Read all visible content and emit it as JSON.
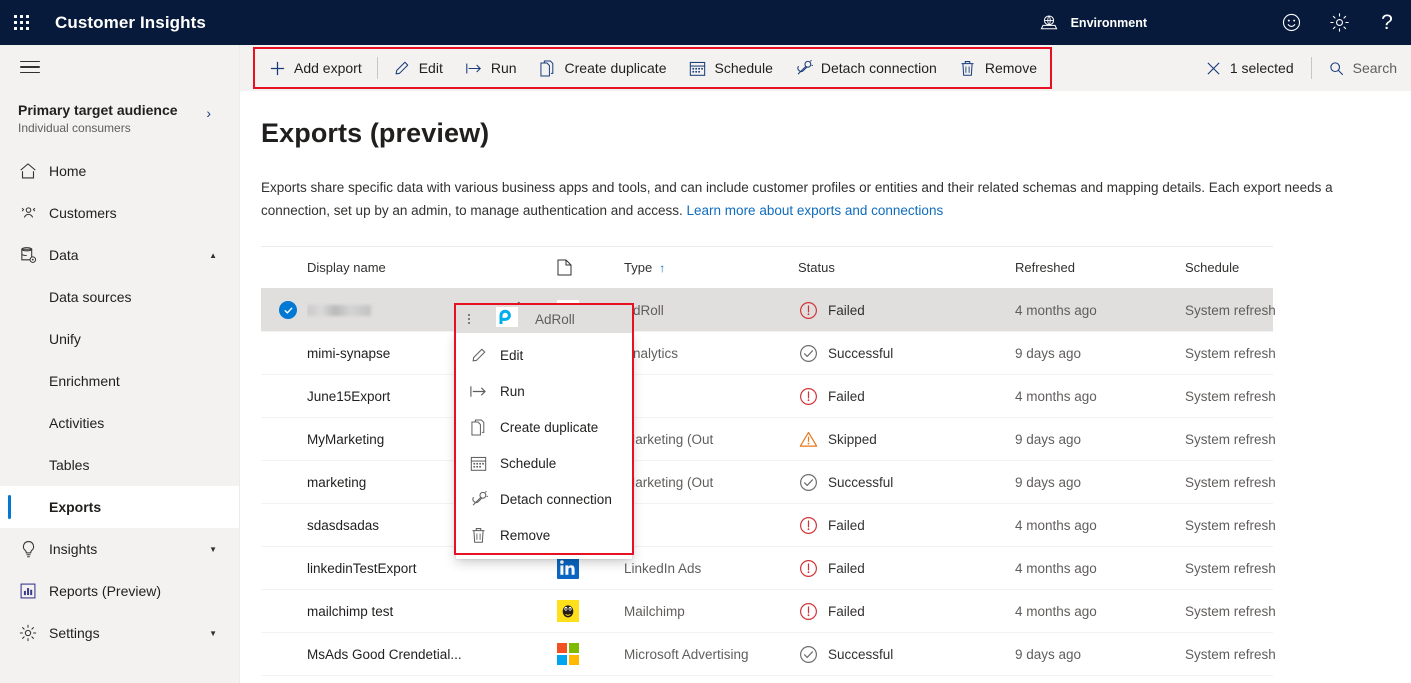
{
  "topbar": {
    "waffle_name": "app-launcher",
    "app_title": "Customer Insights",
    "environment_label": "Environment",
    "icons": [
      "feedback-smiley-icon",
      "gear-icon",
      "help-question-icon"
    ]
  },
  "commandbar": {
    "items": [
      {
        "label": "Add export",
        "icon": "plus-icon"
      },
      {
        "label": "Edit",
        "icon": "pencil-icon"
      },
      {
        "label": "Run",
        "icon": "run-arrow-icon"
      },
      {
        "label": "Create duplicate",
        "icon": "duplicate-icon"
      },
      {
        "label": "Schedule",
        "icon": "calendar-icon"
      },
      {
        "label": "Detach connection",
        "icon": "detach-plug-icon"
      },
      {
        "label": "Remove",
        "icon": "trash-icon"
      }
    ],
    "selected_label": "1 selected",
    "search_label": "Search",
    "highlight_color": "#E81123"
  },
  "sidebar": {
    "hamburger": "hamburger-menu-icon",
    "audience": {
      "title": "Primary target audience",
      "subtitle": "Individual consumers",
      "chevron": "chevron-right-icon"
    },
    "items": [
      {
        "label": "Home",
        "icon": "home-icon",
        "type": "top",
        "expandable": false,
        "active": false
      },
      {
        "label": "Customers",
        "icon": "people-icon",
        "type": "top",
        "expandable": false,
        "active": false
      },
      {
        "label": "Data",
        "icon": "database-icon",
        "type": "top",
        "expandable": true,
        "expanded": true,
        "active": false
      },
      {
        "label": "Data sources",
        "icon": "",
        "type": "sub",
        "expandable": false,
        "active": false
      },
      {
        "label": "Unify",
        "icon": "",
        "type": "sub",
        "expandable": false,
        "active": false
      },
      {
        "label": "Enrichment",
        "icon": "",
        "type": "sub",
        "expandable": false,
        "active": false
      },
      {
        "label": "Activities",
        "icon": "",
        "type": "sub",
        "expandable": false,
        "active": false
      },
      {
        "label": "Tables",
        "icon": "",
        "type": "sub",
        "expandable": false,
        "active": false
      },
      {
        "label": "Exports",
        "icon": "",
        "type": "sub",
        "expandable": false,
        "active": true
      },
      {
        "label": "Insights",
        "icon": "lightbulb-icon",
        "type": "top",
        "expandable": true,
        "expanded": false,
        "active": false
      },
      {
        "label": "Reports (Preview)",
        "icon": "report-chart-icon",
        "type": "top",
        "expandable": false,
        "active": false
      },
      {
        "label": "Settings",
        "icon": "gear-icon",
        "type": "top",
        "expandable": true,
        "expanded": false,
        "active": false
      }
    ]
  },
  "main": {
    "title": "Exports (preview)",
    "description_part1": "Exports share specific data with various business apps and tools, and can include customer profiles or entities and their related schemas and mapping details. Each export needs a connection, set up by an admin, to manage authentication and access. ",
    "description_link": "Learn more about exports and connections"
  },
  "table": {
    "columns": [
      "Display name",
      "Type",
      "Status",
      "Refreshed",
      "Schedule"
    ],
    "sort_column": "Type",
    "sort_direction": "ascending",
    "type_header_icon": "page-icon",
    "rows": [
      {
        "display_name": "",
        "redacted": true,
        "selected": true,
        "edit_icon": "pencil-icon",
        "type": "AdRoll",
        "logo": "adroll-logo",
        "status": "Failed",
        "status_icon": "error-circle-icon",
        "refreshed": "4 months ago",
        "schedule": "System refresh"
      },
      {
        "display_name": "mimi-synapse",
        "redacted": false,
        "selected": false,
        "edit_icon": "",
        "type": "Analytics",
        "logo": "",
        "status": "Successful",
        "status_icon": "check-circle-icon",
        "refreshed": "9 days ago",
        "schedule": "System refresh"
      },
      {
        "display_name": "June15Export",
        "redacted": false,
        "selected": false,
        "edit_icon": "",
        "type": "",
        "logo": "",
        "status": "Failed",
        "status_icon": "error-circle-icon",
        "refreshed": "4 months ago",
        "schedule": "System refresh"
      },
      {
        "display_name": "MyMarketing",
        "redacted": false,
        "selected": false,
        "edit_icon": "",
        "type": "Marketing (Out",
        "logo": "",
        "status": "Skipped",
        "status_icon": "warning-triangle-icon",
        "refreshed": "9 days ago",
        "schedule": "System refresh"
      },
      {
        "display_name": "marketing",
        "redacted": false,
        "selected": false,
        "edit_icon": "",
        "type": "Marketing (Out",
        "logo": "",
        "status": "Successful",
        "status_icon": "check-circle-icon",
        "refreshed": "9 days ago",
        "schedule": "System refresh"
      },
      {
        "display_name": "sdasdsadas",
        "redacted": false,
        "selected": false,
        "edit_icon": "",
        "type": "",
        "logo": "",
        "status": "Failed",
        "status_icon": "error-circle-icon",
        "refreshed": "4 months ago",
        "schedule": "System refresh"
      },
      {
        "display_name": "linkedinTestExport",
        "redacted": false,
        "selected": false,
        "edit_icon": "",
        "type": "LinkedIn Ads",
        "logo": "linkedin-logo",
        "status": "Failed",
        "status_icon": "error-circle-icon",
        "refreshed": "4 months ago",
        "schedule": "System refresh"
      },
      {
        "display_name": "mailchimp test",
        "redacted": false,
        "selected": false,
        "edit_icon": "",
        "type": "Mailchimp",
        "logo": "mailchimp-logo",
        "status": "Failed",
        "status_icon": "error-circle-icon",
        "refreshed": "4 months ago",
        "schedule": "System refresh"
      },
      {
        "display_name": "MsAds Good Crendetial...",
        "redacted": false,
        "selected": false,
        "edit_icon": "",
        "type": "Microsoft Advertising",
        "logo": "microsoft-logo",
        "status": "Successful",
        "status_icon": "check-circle-icon",
        "refreshed": "9 days ago",
        "schedule": "System refresh"
      }
    ]
  },
  "context_menu": {
    "header_label": "AdRoll",
    "header_logo": "adroll-logo",
    "overflow_icon": "more-vertical-icon",
    "items": [
      {
        "label": "Edit",
        "icon": "pencil-icon"
      },
      {
        "label": "Run",
        "icon": "run-arrow-icon"
      },
      {
        "label": "Create duplicate",
        "icon": "duplicate-icon"
      },
      {
        "label": "Schedule",
        "icon": "calendar-icon"
      },
      {
        "label": "Detach connection",
        "icon": "detach-plug-icon"
      },
      {
        "label": "Remove",
        "icon": "trash-icon"
      }
    ],
    "highlight_color": "#E81123"
  },
  "colors": {
    "nav_bg": "#071A3B",
    "chrome_bg": "#F3F2F1",
    "accent": "#0078D4",
    "error": "#D13438",
    "warning": "#E8751A",
    "success": "#605E5C",
    "link": "#0F6CBD",
    "highlight": "#E81123"
  }
}
